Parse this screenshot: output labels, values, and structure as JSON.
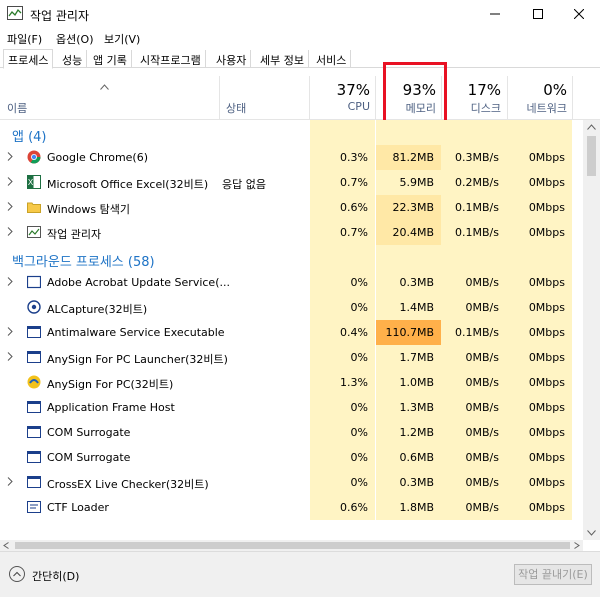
{
  "window": {
    "title": "작업 관리자"
  },
  "menu": [
    "파일(F)",
    "옵션(O)",
    "보기(V)"
  ],
  "tabs": [
    {
      "label": "프로세스",
      "active": true
    },
    {
      "label": "성능"
    },
    {
      "label": "앱 기록"
    },
    {
      "label": "시작프로그램"
    },
    {
      "label": "사용자"
    },
    {
      "label": "세부 정보"
    },
    {
      "label": "서비스"
    }
  ],
  "header": {
    "name": "이름",
    "status": "상태",
    "cpu_pct": "37%",
    "cpu_label": "CPU",
    "mem_pct": "93%",
    "mem_label": "메모리",
    "disk_pct": "17%",
    "disk_label": "디스크",
    "net_pct": "0%",
    "net_label": "네트워크"
  },
  "groups": {
    "apps_label": "앱 (4)",
    "background_label": "백그라운드 프로세스 (58)"
  },
  "apps": [
    {
      "name": "Google Chrome(6)",
      "status": "",
      "cpu": "0.3%",
      "mem": "81.2MB",
      "disk": "0.3MB/s",
      "net": "0Mbps",
      "icon": "chrome-icon",
      "expand": true
    },
    {
      "name": "Microsoft Office Excel(32비트)",
      "status": "응답 없음",
      "cpu": "0.7%",
      "mem": "5.9MB",
      "disk": "0.2MB/s",
      "net": "0Mbps",
      "icon": "excel-icon",
      "expand": true
    },
    {
      "name": "Windows 탐색기",
      "status": "",
      "cpu": "0.6%",
      "mem": "22.3MB",
      "disk": "0.1MB/s",
      "net": "0Mbps",
      "icon": "folder-icon",
      "expand": true
    },
    {
      "name": "작업 관리자",
      "status": "",
      "cpu": "0.7%",
      "mem": "20.4MB",
      "disk": "0.1MB/s",
      "net": "0Mbps",
      "icon": "task-manager-icon",
      "expand": true
    }
  ],
  "background": [
    {
      "name": "Adobe Acrobat Update Service(...",
      "cpu": "0%",
      "mem": "0.3MB",
      "disk": "0MB/s",
      "net": "0Mbps",
      "icon": "window-icon",
      "expand": true
    },
    {
      "name": "ALCapture(32비트)",
      "cpu": "0%",
      "mem": "1.4MB",
      "disk": "0MB/s",
      "net": "0Mbps",
      "icon": "capture-icon",
      "expand": false
    },
    {
      "name": "Antimalware Service Executable",
      "cpu": "0.4%",
      "mem": "110.7MB",
      "disk": "0.1MB/s",
      "net": "0Mbps",
      "icon": "service-icon",
      "expand": true
    },
    {
      "name": "AnySign For PC Launcher(32비트)",
      "cpu": "0%",
      "mem": "1.7MB",
      "disk": "0MB/s",
      "net": "0Mbps",
      "icon": "service-icon",
      "expand": true
    },
    {
      "name": "AnySign For PC(32비트)",
      "cpu": "1.3%",
      "mem": "1.0MB",
      "disk": "0MB/s",
      "net": "0Mbps",
      "icon": "anysign-icon",
      "expand": false
    },
    {
      "name": "Application Frame Host",
      "cpu": "0%",
      "mem": "1.3MB",
      "disk": "0MB/s",
      "net": "0Mbps",
      "icon": "service-icon",
      "expand": false
    },
    {
      "name": "COM Surrogate",
      "cpu": "0%",
      "mem": "1.2MB",
      "disk": "0MB/s",
      "net": "0Mbps",
      "icon": "service-icon",
      "expand": false
    },
    {
      "name": "COM Surrogate",
      "cpu": "0%",
      "mem": "0.6MB",
      "disk": "0MB/s",
      "net": "0Mbps",
      "icon": "service-icon",
      "expand": false
    },
    {
      "name": "CrossEX Live Checker(32비트)",
      "cpu": "0%",
      "mem": "0.3MB",
      "disk": "0MB/s",
      "net": "0Mbps",
      "icon": "service-icon",
      "expand": true
    },
    {
      "name": "CTF Loader",
      "cpu": "0.6%",
      "mem": "1.8MB",
      "disk": "0MB/s",
      "net": "0Mbps",
      "icon": "ctf-icon",
      "expand": false
    }
  ],
  "footer": {
    "fewer_details": "간단히(D)",
    "end_task": "작업 끝내기(E)"
  },
  "colors": {
    "heat_light": "#fff4c4",
    "heat_mid": "#ffe8a6",
    "heat_high": "#ffd27f",
    "heat_highlight": "#ffb04a",
    "group_blue": "#1e73c6",
    "highlight_box": "#e81123"
  }
}
